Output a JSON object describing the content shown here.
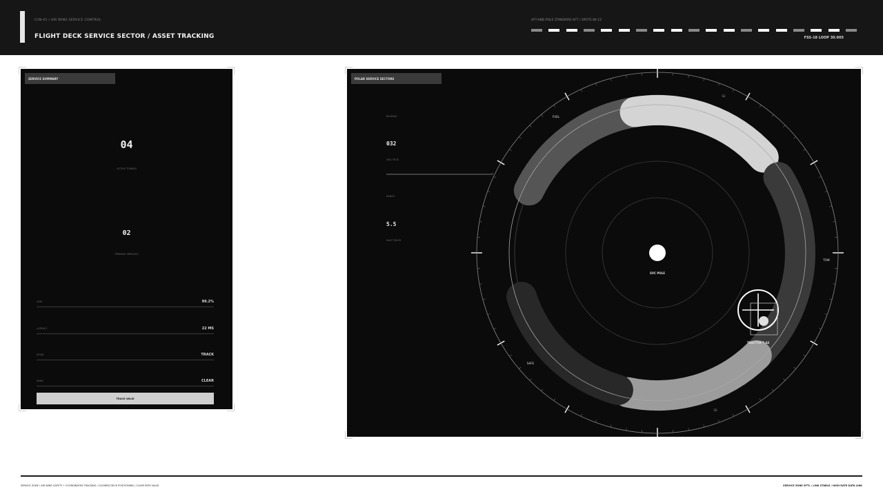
{
  "header": {
    "subtitle": "CVN-01 / AIR WING SERVICE CONTROL",
    "title": "FLIGHT DECK SERVICE SECTOR / ASSET TRACKING",
    "strip_label": "AFT-AND POLE STANDARD AFT / SPOTS 06-12",
    "strip_pattern": [
      "mid",
      "hi",
      "hi",
      "mid",
      "hi",
      "hi",
      "mid",
      "hi",
      "hi",
      "mid",
      "hi",
      "hi",
      "mid",
      "hi",
      "hi",
      "mid",
      "hi",
      "hi",
      "mid"
    ],
    "loop": "FSS-18  LOOP 30.005"
  },
  "summary": {
    "tab_label": "SERVICE SUMMARY",
    "active_count": "04",
    "active_label": "ACTIVE TOWING",
    "pending_count": "02",
    "pending_label": "PENDING SERVICES",
    "rows": [
      {
        "key": "LINK",
        "value": "99.2%"
      },
      {
        "key": "LATENCY",
        "value": "22 MS"
      },
      {
        "key": "MODE",
        "value": "TRACK"
      },
      {
        "key": "WIND",
        "value": "CLEAR"
      }
    ],
    "button_label": "TRACK VALID"
  },
  "polar": {
    "tab_label": "POLAR SERVICE SECTORS",
    "readouts": [
      {
        "key": "BEARING",
        "value": "032",
        "unit": "DEG TRUE"
      },
      {
        "key": "RANGE",
        "value": "5.5",
        "unit": "NAUT MILES"
      }
    ],
    "center_label": "SVC POLE",
    "sector_labels": {
      "fuel": "FUEL",
      "s2": "S2",
      "tow": "TOW",
      "safe": "SAFE",
      "ss": "SS"
    },
    "target_label": "TRACTOR 7-44",
    "colors": {
      "light": "#d4d4d4",
      "mid": "#555555",
      "dark": "#3a3a3a",
      "darker": "#282828",
      "gray": "#9c9c9c"
    }
  },
  "footer": {
    "left": "SERVICE ZONE / AIR WING SAFETY • COORDINATED TRACKING / CLEARED DECK POSITIONING / CLEAR PATH VALID",
    "right": "SERVICE ZONE SPTL / LINK STABLE / HIGH RATE DATA LINK"
  }
}
